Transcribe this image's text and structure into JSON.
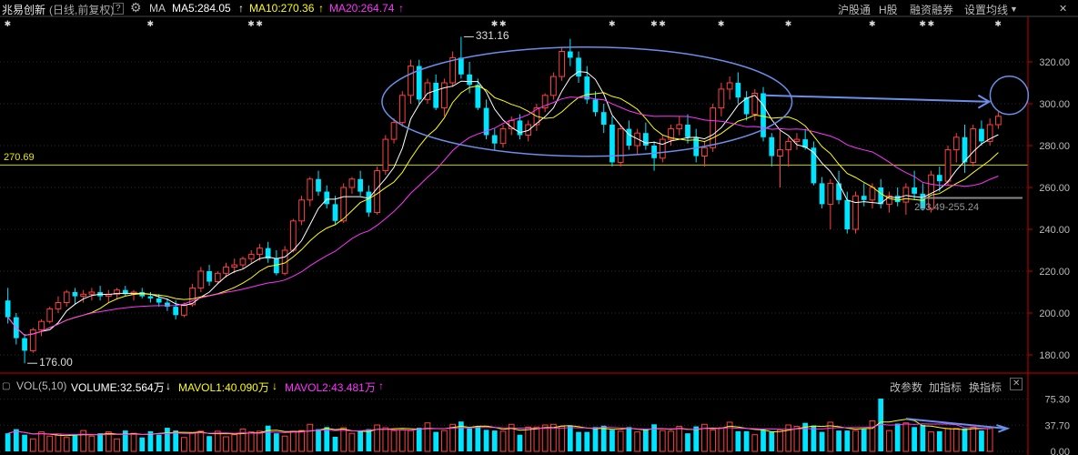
{
  "header": {
    "stock_name": "兆易创新",
    "period": "(日线,前复权)",
    "help": "?",
    "ma_label": "MA",
    "ma5": "MA5:284.05",
    "ma10": "MA10:270.36",
    "ma20": "MA20:264.74",
    "menu": [
      "沪股通",
      "H股",
      "融资融券",
      "设置均线"
    ],
    "colors": {
      "ma5": "#ffffff",
      "ma10": "#ffff00",
      "ma20": "#ff33ff",
      "up": "#ff4040",
      "down": "#00e5ff",
      "grid": "#2a2a2a",
      "axis_line": "#cc0000",
      "annotation": "#6a8fe8"
    }
  },
  "volume_header": {
    "label": "VOL(5,10)",
    "volume": "VOLUME:32.564万",
    "mavol1": "MAVOL1:40.090万",
    "mavol2": "MAVOL2:43.481万",
    "menu": [
      "改参数",
      "加指标",
      "换指标"
    ]
  },
  "annotations": {
    "high": "331.16",
    "low": "176.00",
    "level_line": "270.69",
    "support_range": "253.49-255.24"
  },
  "chart_data": [
    {
      "type": "candlestick",
      "title": "兆易创新 (日线,前复权)",
      "ylim": [
        170,
        340
      ],
      "y_ticks": [
        180,
        200,
        220,
        240,
        260,
        280,
        300,
        320
      ],
      "y_tick_labels": [
        "180.00",
        "200.00",
        "220.00",
        "240.00",
        "260.00",
        "280.00",
        "300.00",
        "320.00"
      ],
      "horizontal_line": 270.69,
      "grid": true,
      "candles": [
        [
          206,
          212,
          195,
          198
        ],
        [
          198,
          200,
          185,
          188
        ],
        [
          188,
          190,
          176,
          182
        ],
        [
          182,
          193,
          181,
          192
        ],
        [
          192,
          197,
          189,
          196
        ],
        [
          196,
          203,
          195,
          202
        ],
        [
          202,
          208,
          200,
          205
        ],
        [
          205,
          211,
          203,
          210
        ],
        [
          210,
          212,
          204,
          208
        ],
        [
          208,
          211,
          205,
          209
        ],
        [
          209,
          212,
          206,
          210
        ],
        [
          210,
          213,
          206,
          208
        ],
        [
          208,
          211,
          205,
          209
        ],
        [
          209,
          212,
          207,
          211
        ],
        [
          211,
          213,
          208,
          209
        ],
        [
          209,
          211,
          206,
          210
        ],
        [
          210,
          212,
          207,
          208
        ],
        [
          208,
          210,
          205,
          207
        ],
        [
          207,
          209,
          203,
          205
        ],
        [
          205,
          207,
          201,
          203
        ],
        [
          203,
          206,
          197,
          199
        ],
        [
          199,
          205,
          198,
          204
        ],
        [
          204,
          214,
          203,
          212
        ],
        [
          212,
          222,
          210,
          220
        ],
        [
          220,
          223,
          213,
          215
        ],
        [
          215,
          220,
          214,
          219
        ],
        [
          219,
          224,
          217,
          222
        ],
        [
          222,
          226,
          219,
          223
        ],
        [
          223,
          227,
          221,
          226
        ],
        [
          226,
          230,
          224,
          228
        ],
        [
          228,
          233,
          225,
          231
        ],
        [
          231,
          234,
          224,
          226
        ],
        [
          226,
          230,
          218,
          219
        ],
        [
          219,
          232,
          218,
          230
        ],
        [
          230,
          245,
          229,
          244
        ],
        [
          244,
          256,
          242,
          254
        ],
        [
          254,
          265,
          251,
          264
        ],
        [
          264,
          268,
          256,
          258
        ],
        [
          258,
          261,
          250,
          252
        ],
        [
          252,
          256,
          242,
          244
        ],
        [
          244,
          262,
          243,
          260
        ],
        [
          260,
          265,
          257,
          264
        ],
        [
          264,
          268,
          256,
          258
        ],
        [
          258,
          261,
          246,
          248
        ],
        [
          248,
          270,
          247,
          268
        ],
        [
          268,
          285,
          266,
          283
        ],
        [
          283,
          293,
          281,
          291
        ],
        [
          291,
          306,
          289,
          304
        ],
        [
          304,
          321,
          300,
          318
        ],
        [
          318,
          321,
          300,
          302
        ],
        [
          302,
          312,
          300,
          310
        ],
        [
          310,
          314,
          297,
          298
        ],
        [
          298,
          312,
          294,
          310
        ],
        [
          310,
          325,
          308,
          322
        ],
        [
          322,
          332,
          312,
          314
        ],
        [
          314,
          320,
          305,
          309
        ],
        [
          309,
          312,
          297,
          298
        ],
        [
          298,
          302,
          283,
          285
        ],
        [
          285,
          288,
          278,
          281
        ],
        [
          281,
          290,
          279,
          288
        ],
        [
          288,
          294,
          285,
          292
        ],
        [
          292,
          295,
          283,
          285
        ],
        [
          285,
          292,
          282,
          290
        ],
        [
          290,
          300,
          287,
          298
        ],
        [
          298,
          305,
          296,
          304
        ],
        [
          304,
          315,
          302,
          313
        ],
        [
          313,
          327,
          311,
          325
        ],
        [
          325,
          331,
          318,
          322
        ],
        [
          322,
          325,
          310,
          313
        ],
        [
          313,
          318,
          300,
          302
        ],
        [
          302,
          306,
          294,
          296
        ],
        [
          296,
          300,
          286,
          290
        ],
        [
          290,
          294,
          270,
          272
        ],
        [
          272,
          290,
          270,
          288
        ],
        [
          288,
          292,
          278,
          280
        ],
        [
          280,
          288,
          276,
          286
        ],
        [
          286,
          291,
          278,
          280
        ],
        [
          280,
          282,
          268,
          274
        ],
        [
          274,
          285,
          272,
          283
        ],
        [
          283,
          290,
          280,
          288
        ],
        [
          288,
          294,
          285,
          290
        ],
        [
          290,
          295,
          281,
          284
        ],
        [
          284,
          288,
          272,
          275
        ],
        [
          275,
          282,
          270,
          279
        ],
        [
          279,
          300,
          277,
          298
        ],
        [
          298,
          310,
          294,
          307
        ],
        [
          307,
          313,
          302,
          310
        ],
        [
          310,
          315,
          300,
          303
        ],
        [
          303,
          306,
          292,
          295
        ],
        [
          295,
          307,
          292,
          305
        ],
        [
          305,
          308,
          282,
          284
        ],
        [
          284,
          286,
          270,
          275
        ],
        [
          275,
          287,
          260,
          278
        ],
        [
          278,
          284,
          270,
          282
        ],
        [
          282,
          286,
          278,
          283
        ],
        [
          283,
          288,
          278,
          279
        ],
        [
          279,
          282,
          261,
          262
        ],
        [
          262,
          265,
          250,
          252
        ],
        [
          252,
          264,
          240,
          262
        ],
        [
          262,
          268,
          252,
          254
        ],
        [
          254,
          258,
          238,
          240
        ],
        [
          240,
          258,
          238,
          256
        ],
        [
          256,
          262,
          251,
          254
        ],
        [
          254,
          262,
          250,
          260
        ],
        [
          260,
          264,
          250,
          252
        ],
        [
          252,
          258,
          248,
          256
        ],
        [
          256,
          260,
          251,
          253
        ],
        [
          253,
          262,
          247,
          260
        ],
        [
          260,
          268,
          254,
          257
        ],
        [
          257,
          262,
          249,
          250
        ],
        [
          250,
          268,
          248,
          266
        ],
        [
          266,
          270,
          258,
          263
        ],
        [
          263,
          280,
          261,
          278
        ],
        [
          278,
          286,
          272,
          284
        ],
        [
          284,
          290,
          267,
          272
        ],
        [
          272,
          290,
          270,
          288
        ],
        [
          288,
          292,
          280,
          282
        ],
        [
          282,
          293,
          280,
          290
        ],
        [
          290,
          296,
          288,
          294
        ]
      ]
    },
    {
      "type": "bar",
      "title": "VOL(5,10)",
      "ylim": [
        0,
        80
      ],
      "y_ticks": [
        0,
        37.7,
        75.3
      ],
      "y_tick_labels": [
        "0.00",
        "37.70",
        "75.30"
      ],
      "values": [
        26,
        32,
        24,
        18,
        28,
        22,
        25,
        20,
        23,
        30,
        22,
        26,
        28,
        18,
        30,
        26,
        20,
        29,
        24,
        34,
        30,
        20,
        27,
        29,
        22,
        29,
        21,
        24,
        32,
        28,
        29,
        37,
        26,
        22,
        29,
        30,
        39,
        32,
        35,
        21,
        34,
        26,
        29,
        32,
        38,
        34,
        30,
        31,
        30,
        34,
        41,
        28,
        30,
        39,
        43,
        33,
        36,
        31,
        30,
        29,
        39,
        24,
        35,
        35,
        38,
        39,
        36,
        37,
        28,
        28,
        35,
        37,
        31,
        29,
        35,
        28,
        32,
        39,
        30,
        29,
        36,
        26,
        36,
        39,
        31,
        34,
        42,
        29,
        29,
        24,
        31,
        28,
        31,
        38,
        36,
        41,
        37,
        28,
        42,
        30,
        30,
        30,
        32,
        44,
        76,
        30,
        40,
        41,
        35,
        38,
        28,
        29,
        33,
        33,
        33,
        35,
        30,
        33
      ]
    }
  ]
}
